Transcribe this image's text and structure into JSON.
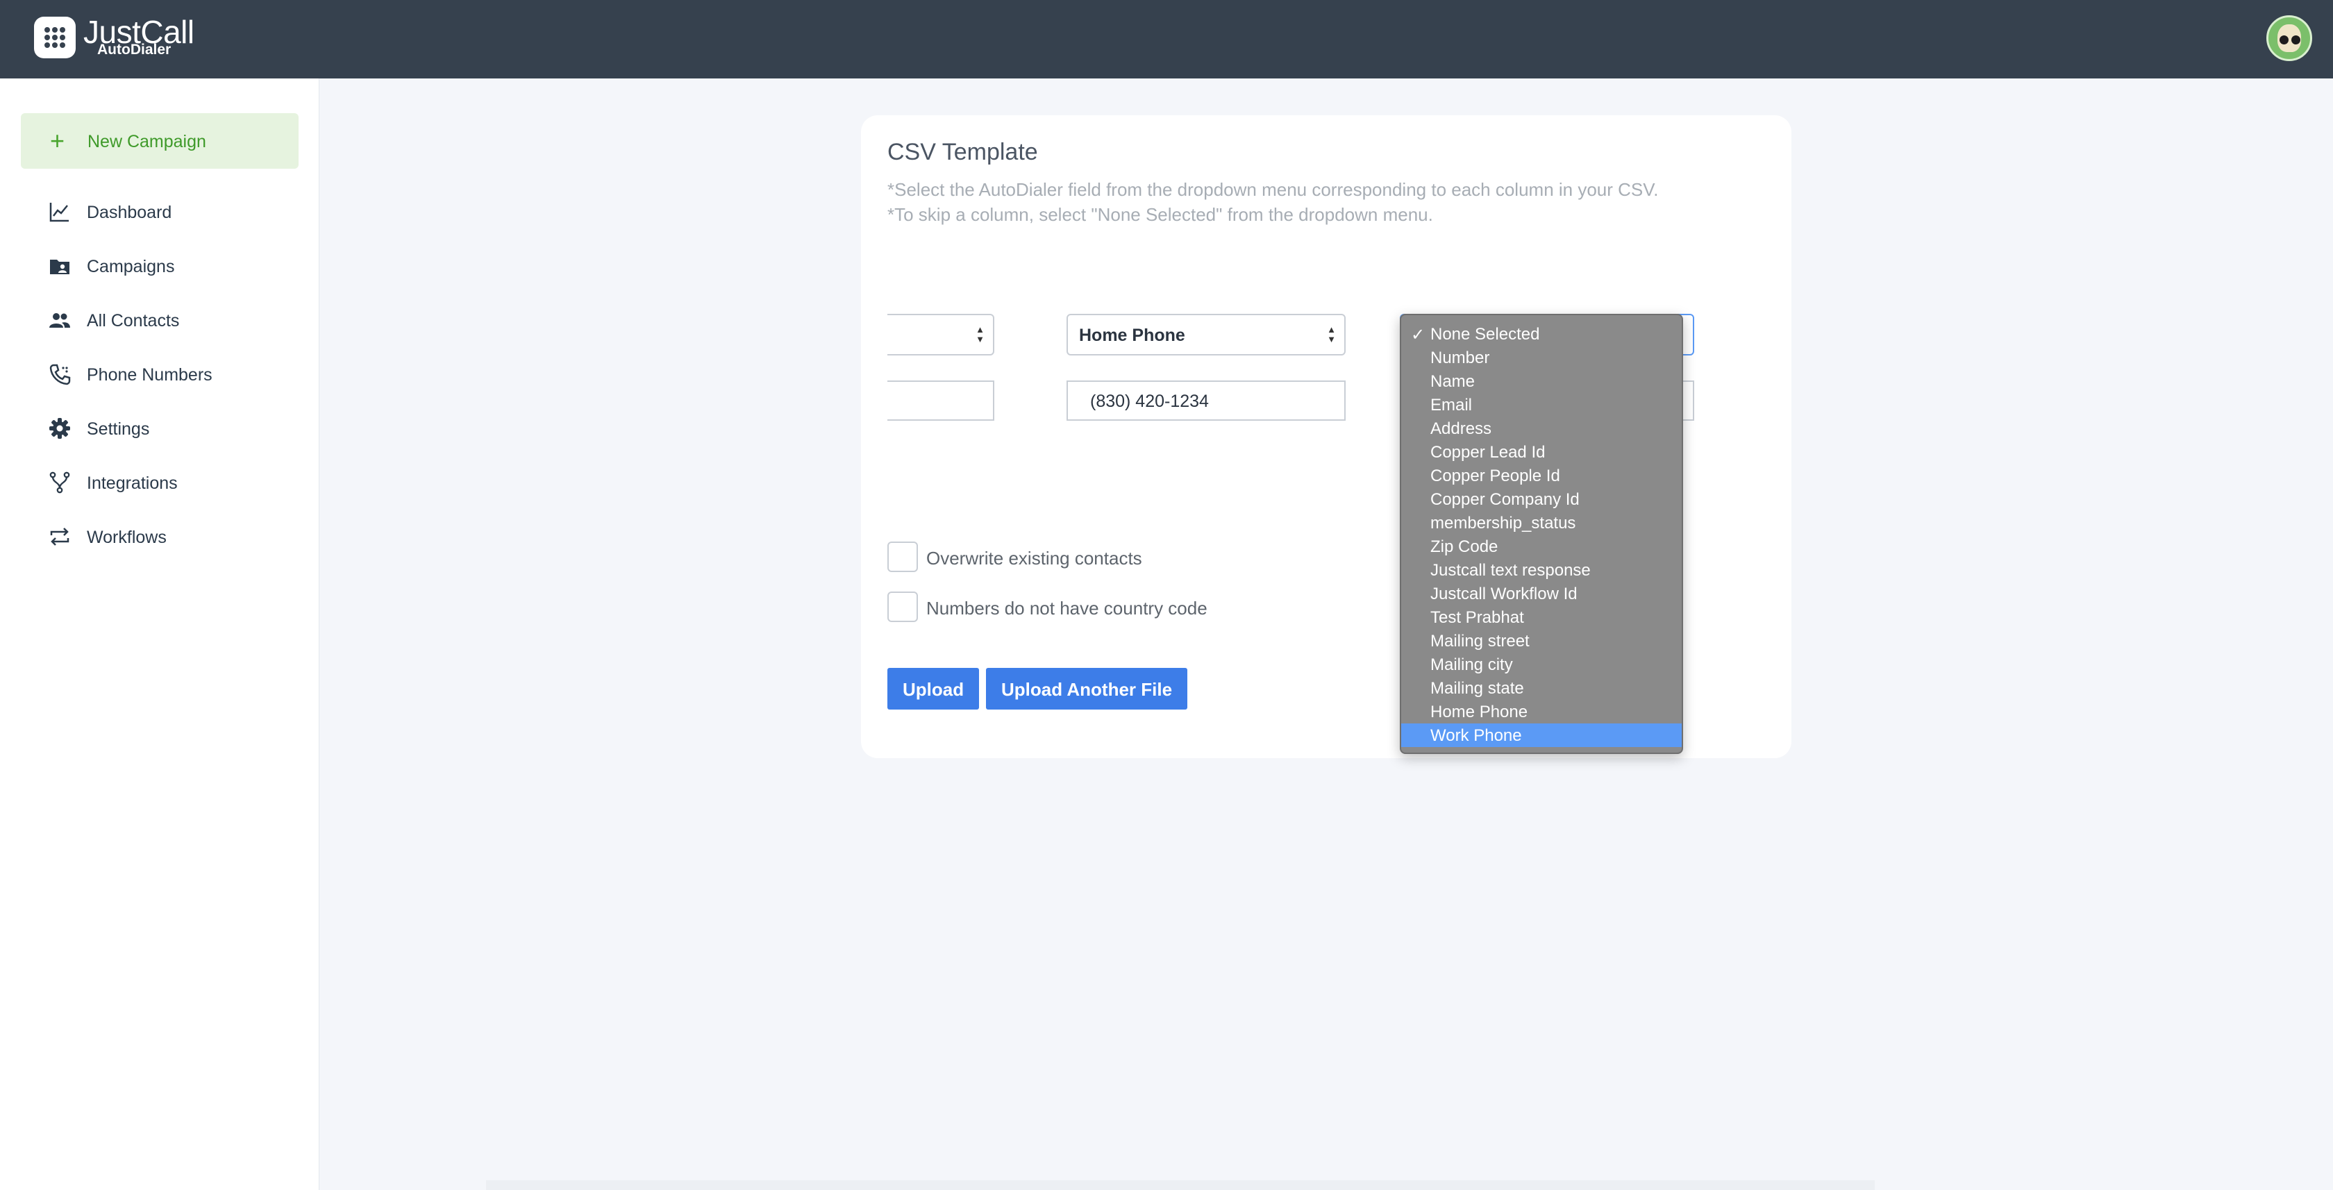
{
  "app": {
    "brand_name": "JustCall",
    "brand_sub": "AutoDialer"
  },
  "sidebar": {
    "new_campaign_label": "New Campaign",
    "items": [
      {
        "label": "Dashboard",
        "icon": "chart-line-icon"
      },
      {
        "label": "Campaigns",
        "icon": "folder-user-icon"
      },
      {
        "label": "All Contacts",
        "icon": "people-icon"
      },
      {
        "label": "Phone Numbers",
        "icon": "phone-icon"
      },
      {
        "label": "Settings",
        "icon": "gear-icon"
      },
      {
        "label": "Integrations",
        "icon": "branch-icon"
      },
      {
        "label": "Workflows",
        "icon": "repeat-icon"
      }
    ]
  },
  "card": {
    "title": "CSV Template",
    "hint1": "*Select the AutoDialer field from the dropdown menu corresponding to each column in your CSV.",
    "hint2": "*To skip a column, select \"None Selected\" from the dropdown menu.",
    "columns": [
      {
        "selected": "",
        "sample": ""
      },
      {
        "selected": "Home Phone",
        "sample": "(830) 420-1234"
      },
      {
        "selected": "None Selected",
        "sample": ""
      }
    ],
    "overwrite_label": "Overwrite existing contacts",
    "country_code_label": "Numbers do not have country code",
    "upload_label": "Upload",
    "upload_another_label": "Upload Another File"
  },
  "dropdown": {
    "checked": "None Selected",
    "highlighted": "Work Phone",
    "options": [
      "None Selected",
      "Number",
      "Name",
      "Email",
      "Address",
      "Copper Lead Id",
      "Copper People Id",
      "Copper Company Id",
      "membership_status",
      "Zip Code",
      "Justcall text response",
      "Justcall Workflow Id",
      "Test Prabhat",
      "Mailing street",
      "Mailing city",
      "Mailing state",
      "Home Phone",
      "Work Phone"
    ]
  }
}
